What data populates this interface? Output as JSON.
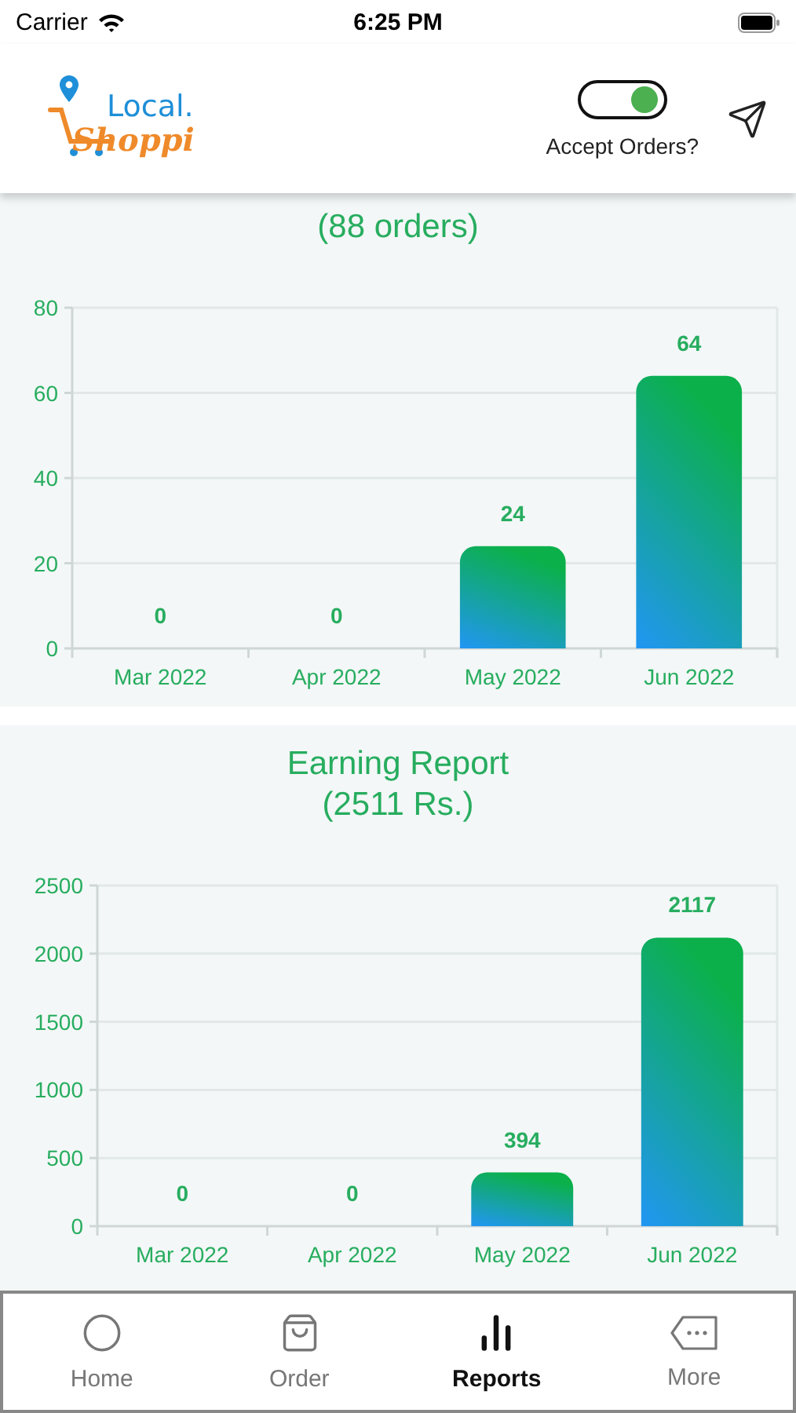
{
  "status_bar": {
    "carrier": "Carrier",
    "time": "6:25 PM"
  },
  "header": {
    "logo": {
      "top": "Local.",
      "bottom": "Shoppi"
    },
    "accept_orders": {
      "label": "Accept Orders?",
      "on": true
    }
  },
  "reports": [
    {
      "subtitle": "(88 orders)",
      "chart_data": {
        "type": "bar",
        "categories": [
          "Mar 2022",
          "Apr 2022",
          "May 2022",
          "Jun 2022"
        ],
        "values": [
          0,
          0,
          24,
          64
        ],
        "grid": true,
        "ylim": [
          0,
          80
        ],
        "yticks": [
          0,
          20,
          40,
          60,
          80
        ],
        "data_labels": true
      }
    },
    {
      "title": "Earning Report",
      "subtitle": "(2511 Rs.)",
      "chart_data": {
        "type": "bar",
        "categories": [
          "Mar 2022",
          "Apr 2022",
          "May 2022",
          "Jun 2022"
        ],
        "values": [
          0,
          0,
          394,
          2117
        ],
        "grid": true,
        "ylim": [
          0,
          2500
        ],
        "yticks": [
          0,
          500,
          1000,
          1500,
          2000,
          2500
        ],
        "data_labels": true
      }
    }
  ],
  "tab_bar": [
    {
      "label": "Home",
      "kind": "home",
      "selected": false
    },
    {
      "label": "Order",
      "kind": "bag",
      "selected": false
    },
    {
      "label": "Reports",
      "kind": "chart",
      "selected": true
    },
    {
      "label": "More",
      "kind": "more",
      "selected": false
    }
  ]
}
